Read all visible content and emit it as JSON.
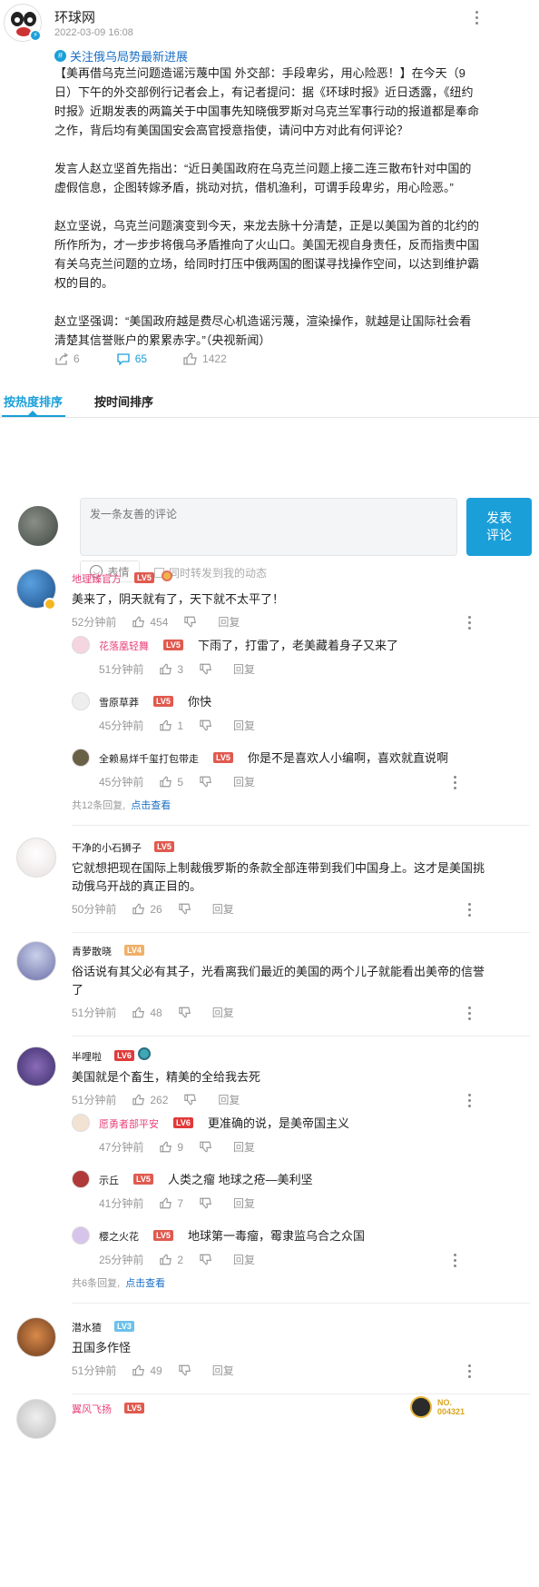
{
  "author": {
    "name": "环球网",
    "time": "2022-03-09 16:08"
  },
  "topic": "关注俄乌局势最新进展",
  "article": {
    "p1": "【美再借乌克兰问题造谣污蔑中国 外交部：手段卑劣，用心险恶！】在今天（9日）下午的外交部例行记者会上，有记者提问：据《环球时报》近日透露，《纽约时报》近期发表的两篇关于中国事先知晓俄罗斯对乌克兰军事行动的报道都是奉命之作，背后均有美国国安会高官授意指使，请问中方对此有何评论？",
    "p2": "发言人赵立坚首先指出：“近日美国政府在乌克兰问题上接二连三散布针对中国的虚假信息，企图转嫁矛盾，挑动对抗，借机渔利，可谓手段卑劣，用心险恶。”",
    "p3": "赵立坚说，乌克兰问题演变到今天，来龙去脉十分清楚，正是以美国为首的北约的所作所为，才一步步将俄乌矛盾推向了火山口。美国无视自身责任，反而指责中国有关乌克兰问题的立场，给同时打压中俄两国的图谋寻找操作空间，以达到维护霸权的目的。",
    "p4": "赵立坚强调：“美国政府越是费尽心机造谣污蔑，渲染操作，就越是让国际社会看清楚其信誉账户的累累赤字。”（央视新闻）"
  },
  "stats": {
    "share": "6",
    "comment": "65",
    "like": "1422"
  },
  "tabs": {
    "hot": "按热度排序",
    "time": "按时间排序"
  },
  "composer": {
    "placeholder": "发一条友善的评论",
    "submit1": "发表",
    "submit2": "评论",
    "emoji": "表情",
    "forward": "同时转发到我的动态"
  },
  "common": {
    "reply": "回复"
  },
  "colors": {
    "accent": "#1a9fd9",
    "level": "#e05a4f",
    "level_faint": "#f0b06a",
    "level_blue": "#6bc1ea"
  },
  "comments": [
    {
      "user": "地理臻官方",
      "level": "LV5",
      "text": "美来了，阴天就有了，天下就不太平了！",
      "time": "52分钟前",
      "likes": "454",
      "replies": [
        {
          "user": "花落凰轻舞",
          "level": "LV5",
          "text": "下雨了，打雷了，老美藏着身子又来了",
          "time": "51分钟前",
          "likes": "3"
        },
        {
          "user": "雪原草莽",
          "level": "LV5",
          "text": "你快",
          "time": "45分钟前",
          "likes": "1"
        },
        {
          "user": "全赖易烊千玺打包带走",
          "level": "LV5",
          "text": "你是不是喜欢人小编啊，喜欢就直说啊",
          "time": "45分钟前",
          "likes": "5"
        }
      ],
      "summary_pre": "共",
      "summary_count": "12",
      "summary_post": "条回复,",
      "summary_link": "点击查看"
    },
    {
      "user": "干净的小石狮子",
      "level": "LV5",
      "text": "它就想把现在国际上制裁俄罗斯的条款全部连带到我们中国身上。这才是美国挑动俄乌开战的真正目的。",
      "time": "50分钟前",
      "likes": "26"
    },
    {
      "user": "青萝散晓",
      "level": "LV4",
      "text": "俗话说有其父必有其子，光看离我们最近的美国的两个儿子就能看出美帝的信誉了",
      "time": "51分钟前",
      "likes": "48"
    },
    {
      "user": "半哩啦",
      "level": "LV6",
      "text": "美国就是个畜生，精美的全给我去死",
      "time": "51分钟前",
      "likes": "262",
      "replies": [
        {
          "user": "愿勇者部平安",
          "level": "LV6",
          "text": "更准确的说，是美帝国主义",
          "time": "47分钟前",
          "likes": "9"
        },
        {
          "user": "示丘",
          "level": "LV5",
          "text": "人类之瘤 地球之疮—美利坚",
          "time": "41分钟前",
          "likes": "7"
        },
        {
          "user": "樱之火花",
          "level": "LV5",
          "text": "地球第一毒瘤，霉隶监乌合之众国",
          "time": "25分钟前",
          "likes": "2"
        }
      ],
      "summary_pre": "共",
      "summary_count": "6",
      "summary_post": "条回复,",
      "summary_link": "点击查看"
    },
    {
      "user": "潜水猹",
      "level": "LV3",
      "text": "丑国多作怪",
      "time": "51分钟前",
      "likes": "49"
    },
    {
      "user": "翼风飞扬",
      "level": "LV5",
      "badge": "NO.\n004321"
    }
  ]
}
